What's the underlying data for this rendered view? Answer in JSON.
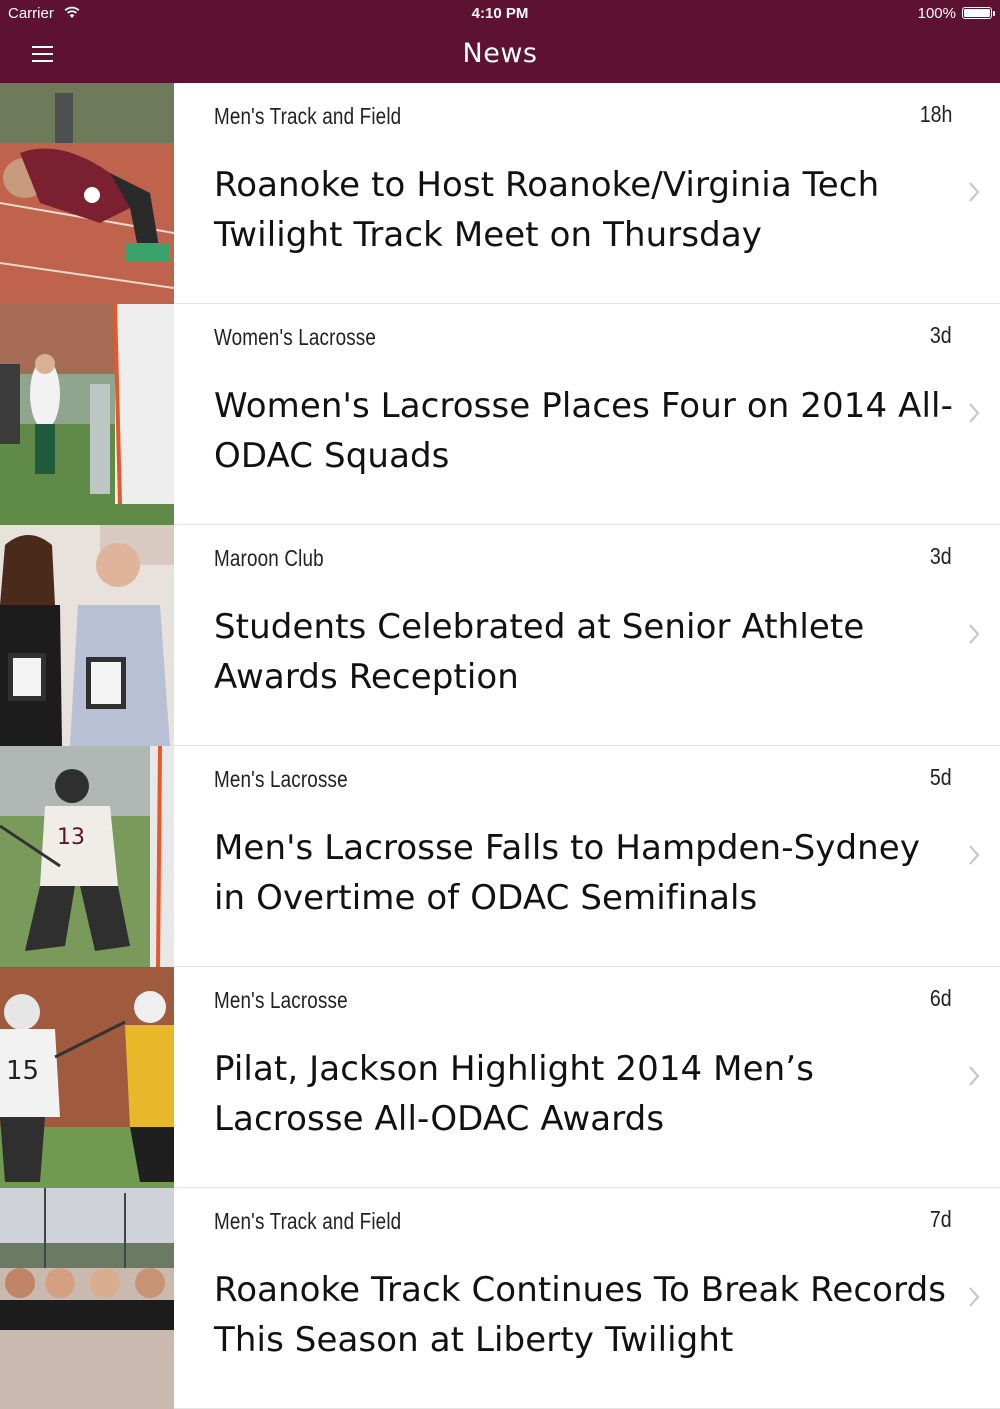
{
  "status_bar": {
    "carrier": "Carrier",
    "time": "4:10 PM",
    "battery": "100%"
  },
  "nav": {
    "title": "News",
    "menu_icon": "hamburger-menu-icon"
  },
  "colors": {
    "brand": "#5c1230",
    "divider": "#e4e4e4",
    "chevron": "#c7c7cc"
  },
  "news": [
    {
      "category": "Men's Track and Field",
      "age": "18h",
      "headline": "Roanoke to Host Roanoke/Virginia Tech Twilight Track Meet on Thursday",
      "image": "track-athlete-starting-blocks"
    },
    {
      "category": "Women's Lacrosse",
      "age": "3d",
      "headline": "Women's Lacrosse Places Four on 2014 All-ODAC Squads",
      "image": "womens-lacrosse-game"
    },
    {
      "category": "Maroon Club",
      "age": "3d",
      "headline": "Students Celebrated at Senior Athlete Awards Reception",
      "image": "award-recipients-with-plaques"
    },
    {
      "category": "Men's Lacrosse",
      "age": "5d",
      "headline": "Men's Lacrosse Falls to Hampden-Sydney in Overtime of ODAC Semifinals",
      "image": "lacrosse-player-13"
    },
    {
      "category": "Men's Lacrosse",
      "age": "6d",
      "headline": "Pilat, Jackson Highlight 2014 Men’s Lacrosse All-ODAC Awards",
      "image": "lacrosse-player-15"
    },
    {
      "category": "Men's Track and Field",
      "age": "7d",
      "headline": "Roanoke Track Continues To Break Records This Season at Liberty Twilight",
      "image": "track-team-group-photo"
    }
  ]
}
